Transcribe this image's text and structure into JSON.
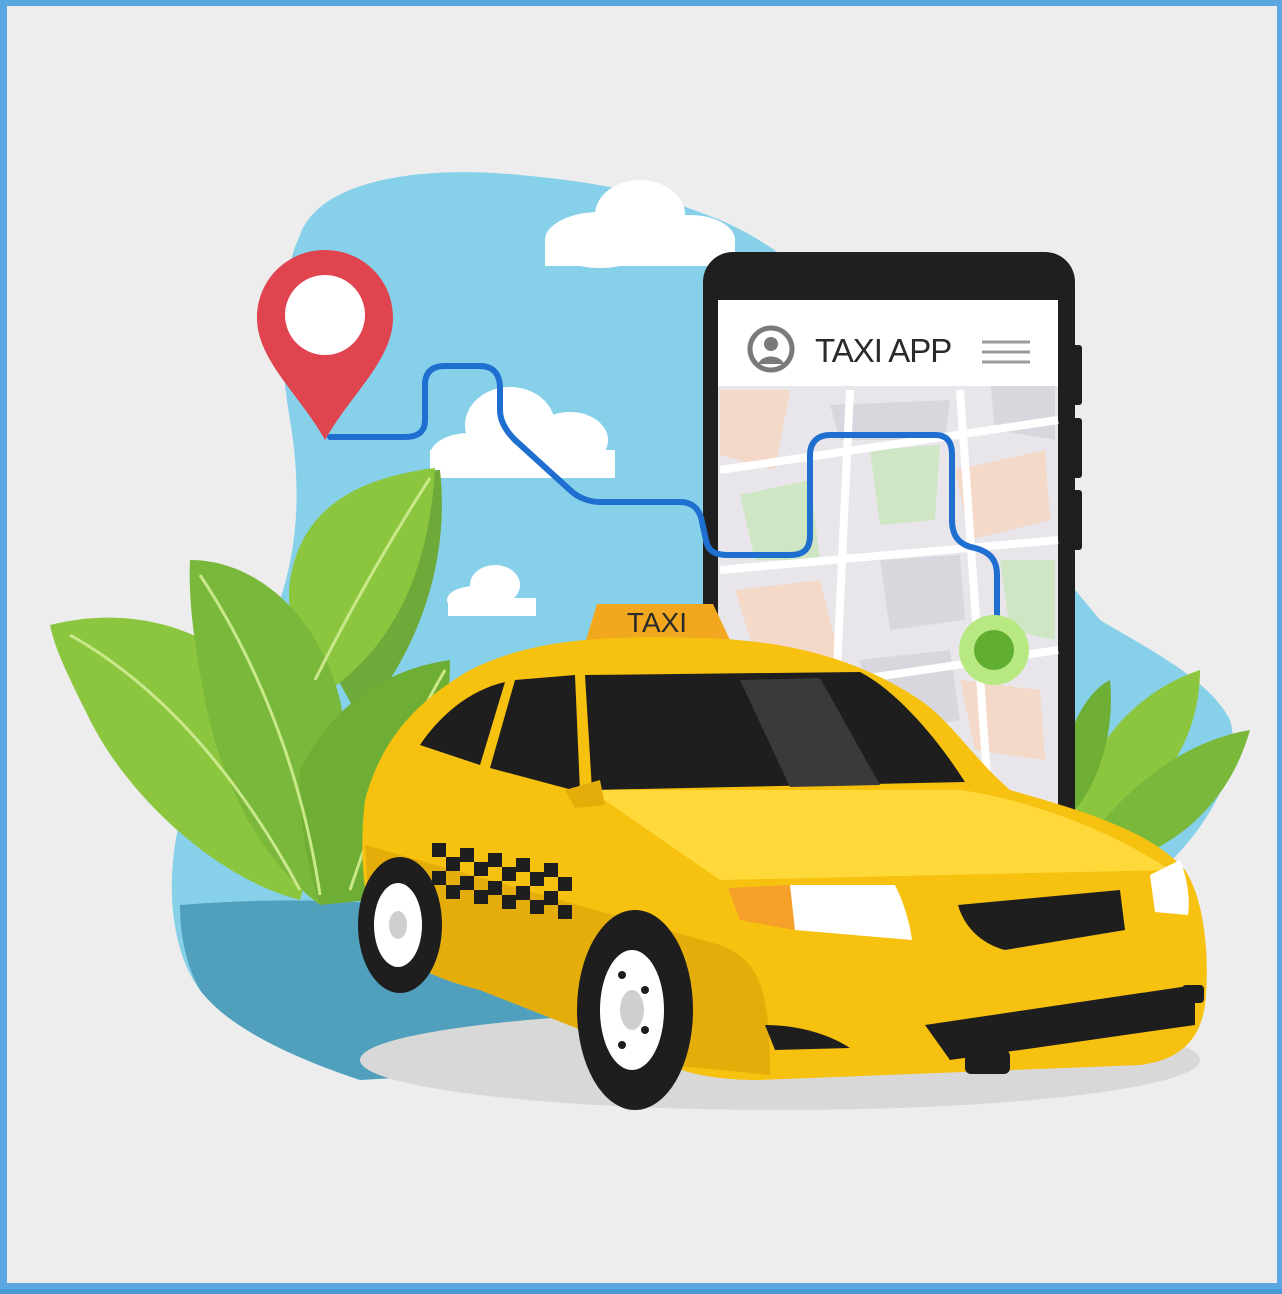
{
  "app_header": {
    "title": "TAXI APP",
    "avatar_icon": "user-avatar-icon",
    "menu_icon": "hamburger-menu-icon"
  },
  "taxi": {
    "roof_sign": "TAXI",
    "body_color": "#f6c10f",
    "sign_color": "#f2a81e"
  },
  "map": {
    "pin_icon": "location-pin-icon",
    "destination_icon": "destination-dot-icon",
    "route_color": "#1f6fd0",
    "pin_color": "#e0444f",
    "destination_color": "#7bc143"
  },
  "colors": {
    "page_background": "#ededed",
    "sky": "#86d0ea",
    "ground": "#4f9fbd",
    "leaf": "#8cc63f"
  }
}
